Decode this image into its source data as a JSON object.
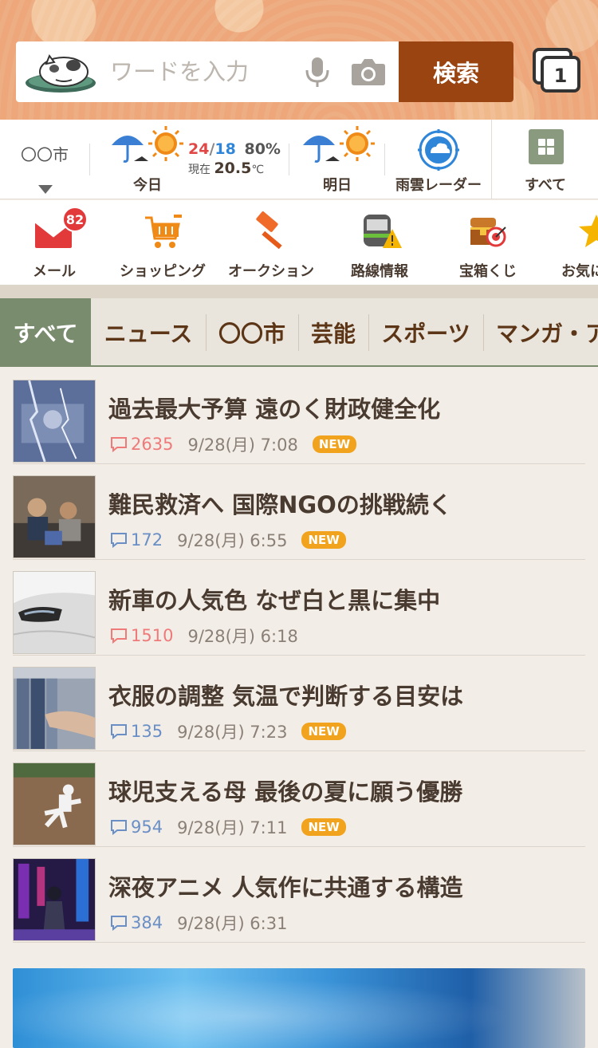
{
  "search": {
    "placeholder": "ワードを入力",
    "button_label": "検索",
    "tab_count": "1"
  },
  "weather": {
    "city": "〇〇市",
    "today_label": "今日",
    "high": "24",
    "separator": "/",
    "low": "18",
    "humidity": "80%",
    "current_label": "現在",
    "current_temp": "20.5",
    "current_unit": "℃",
    "tomorrow_label": "明日",
    "radar_label": "雨雲レーダー",
    "all_label": "すべて"
  },
  "services": [
    {
      "label": "メール",
      "badge": "82",
      "icon": "mail-icon"
    },
    {
      "label": "ショッピング",
      "icon": "cart-icon"
    },
    {
      "label": "オークション",
      "icon": "gavel-icon"
    },
    {
      "label": "路線情報",
      "icon": "train-icon"
    },
    {
      "label": "宝箱くじ",
      "icon": "treasure-icon"
    },
    {
      "label": "お気に",
      "icon": "star-icon"
    }
  ],
  "categories": [
    "すべて",
    "ニュース",
    "〇〇市",
    "芸能",
    "スポーツ",
    "マンガ・ア"
  ],
  "news": [
    {
      "headline": "過去最大予算 遠のく財政健全化",
      "comments": "2635",
      "time": "9/28(月) 7:08",
      "new": "NEW"
    },
    {
      "headline": "難民救済へ 国際NGOの挑戦続く",
      "comments": "172",
      "time": "9/28(月) 6:55",
      "new": "NEW"
    },
    {
      "headline": "新車の人気色 なぜ白と黒に集中",
      "comments": "1510",
      "time": "9/28(月) 6:18",
      "new": ""
    },
    {
      "headline": "衣服の調整 気温で判断する目安は",
      "comments": "135",
      "time": "9/28(月) 7:23",
      "new": "NEW"
    },
    {
      "headline": "球児支える母 最後の夏に願う優勝",
      "comments": "954",
      "time": "9/28(月) 7:11",
      "new": "NEW"
    },
    {
      "headline": "深夜アニメ 人気作に共通する構造",
      "comments": "384",
      "time": "9/28(月) 6:31",
      "new": ""
    }
  ]
}
